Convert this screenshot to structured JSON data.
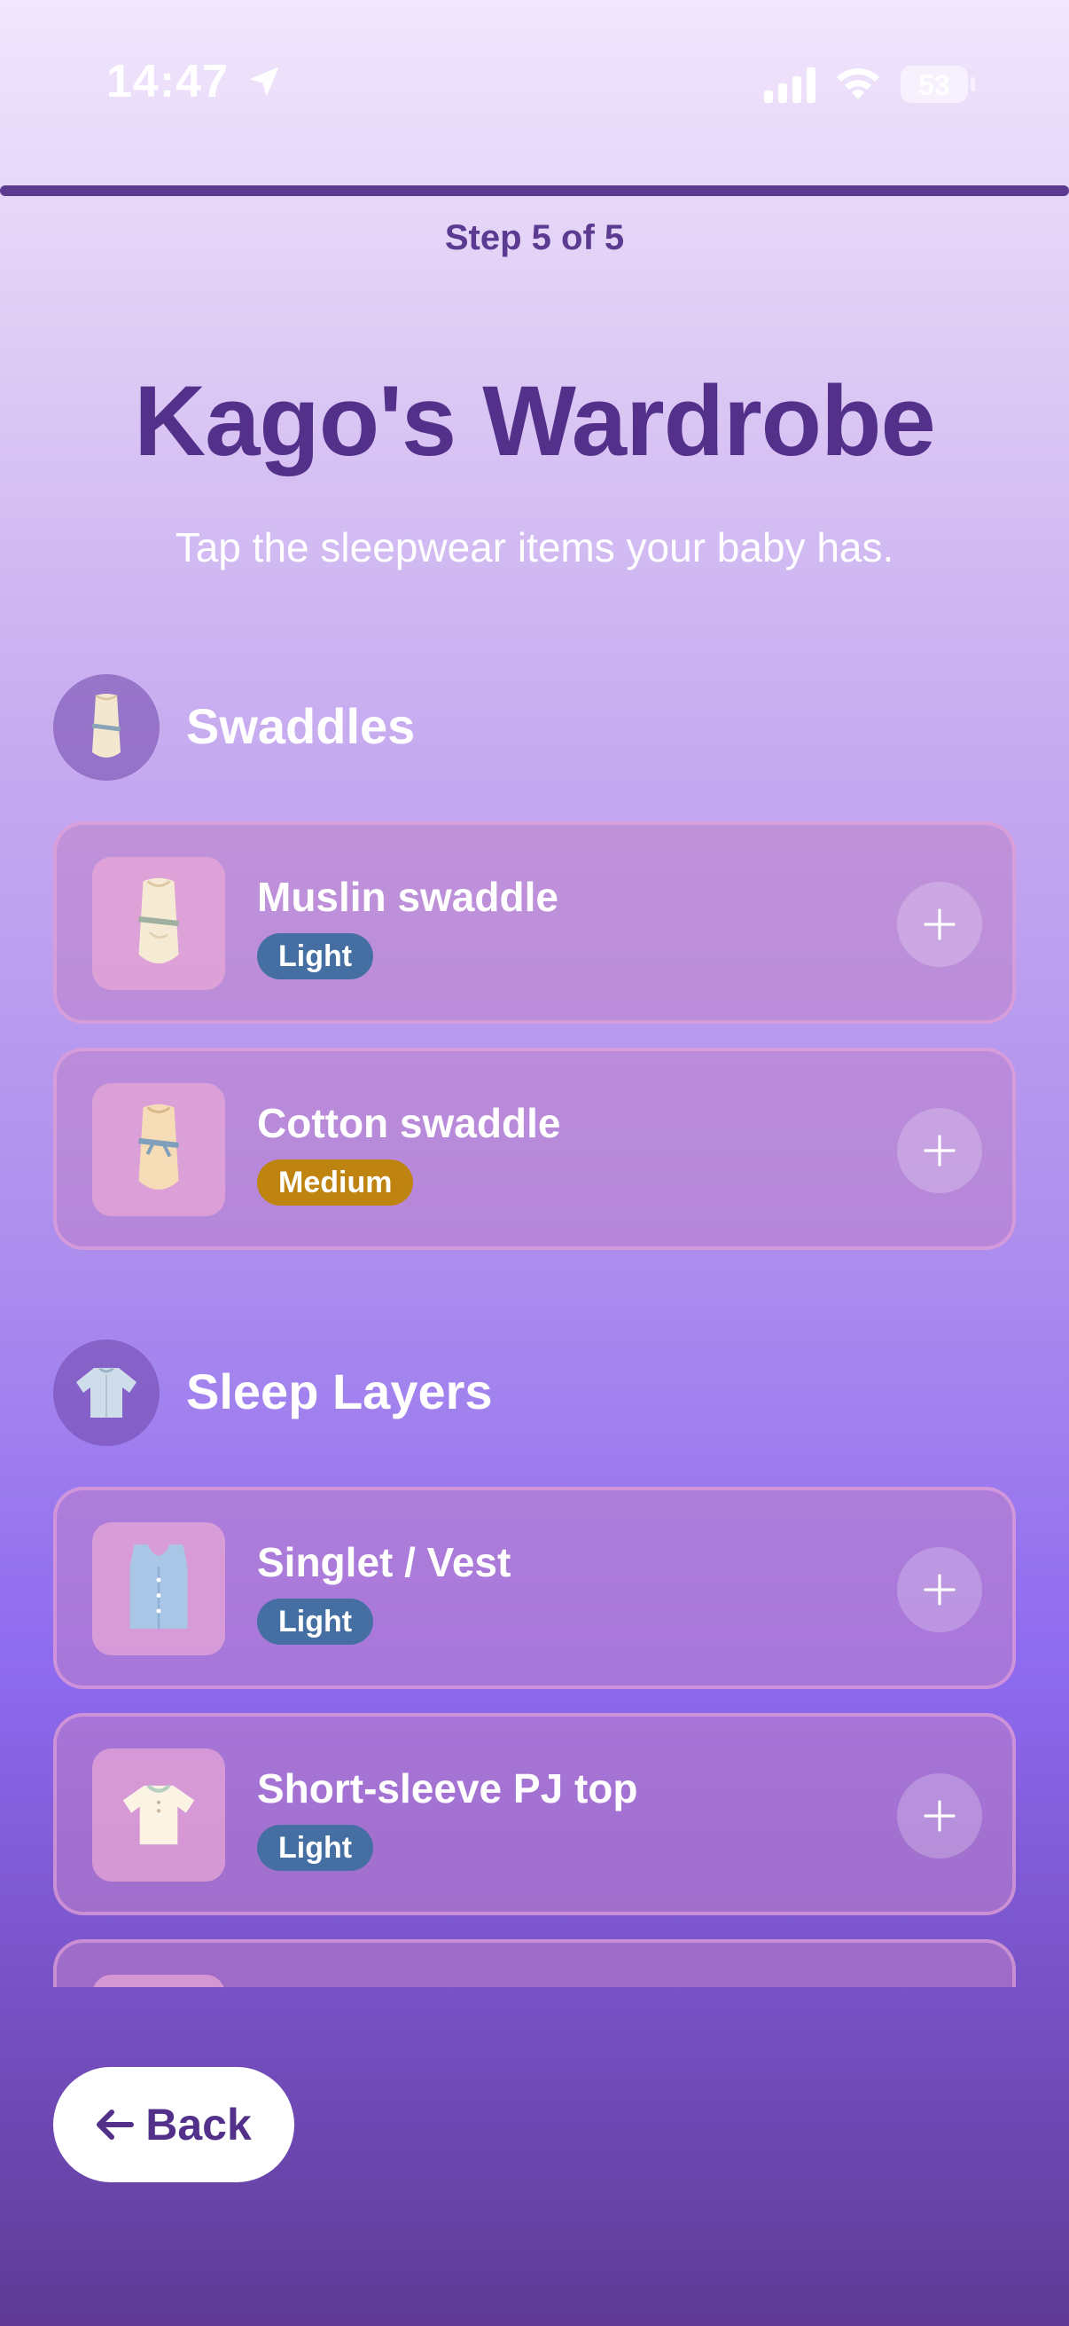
{
  "status_bar": {
    "time": "14:47",
    "battery": "53",
    "icons": [
      "location-arrow-icon",
      "cellular-signal-icon",
      "wifi-icon",
      "battery-icon"
    ]
  },
  "progress": {
    "step_label": "Step 5 of 5",
    "fraction": 1.0,
    "fill_color": "#5c3a8f"
  },
  "header": {
    "title": "Kago's Wardrobe",
    "subtitle": "Tap the sleepwear items your baby has."
  },
  "sections": [
    {
      "title": "Swaddles",
      "icon": "swaddle-icon",
      "items": [
        {
          "name": "Muslin swaddle",
          "tag": "Light",
          "icon": "muslin-swaddle-icon"
        },
        {
          "name": "Cotton swaddle",
          "tag": "Medium",
          "icon": "cotton-swaddle-icon"
        }
      ]
    },
    {
      "title": "Sleep Layers",
      "icon": "sleep-layers-icon",
      "items": [
        {
          "name": "Singlet / Vest",
          "tag": "Light",
          "icon": "singlet-vest-icon"
        },
        {
          "name": "Short-sleeve PJ top",
          "tag": "Light",
          "icon": "short-sleeve-pj-top-icon"
        }
      ]
    }
  ],
  "tag_colors": {
    "Light": "#456fa3",
    "Medium": "#bf8410"
  },
  "footer": {
    "back_label": "Back",
    "back_icon": "arrow-left-icon"
  }
}
